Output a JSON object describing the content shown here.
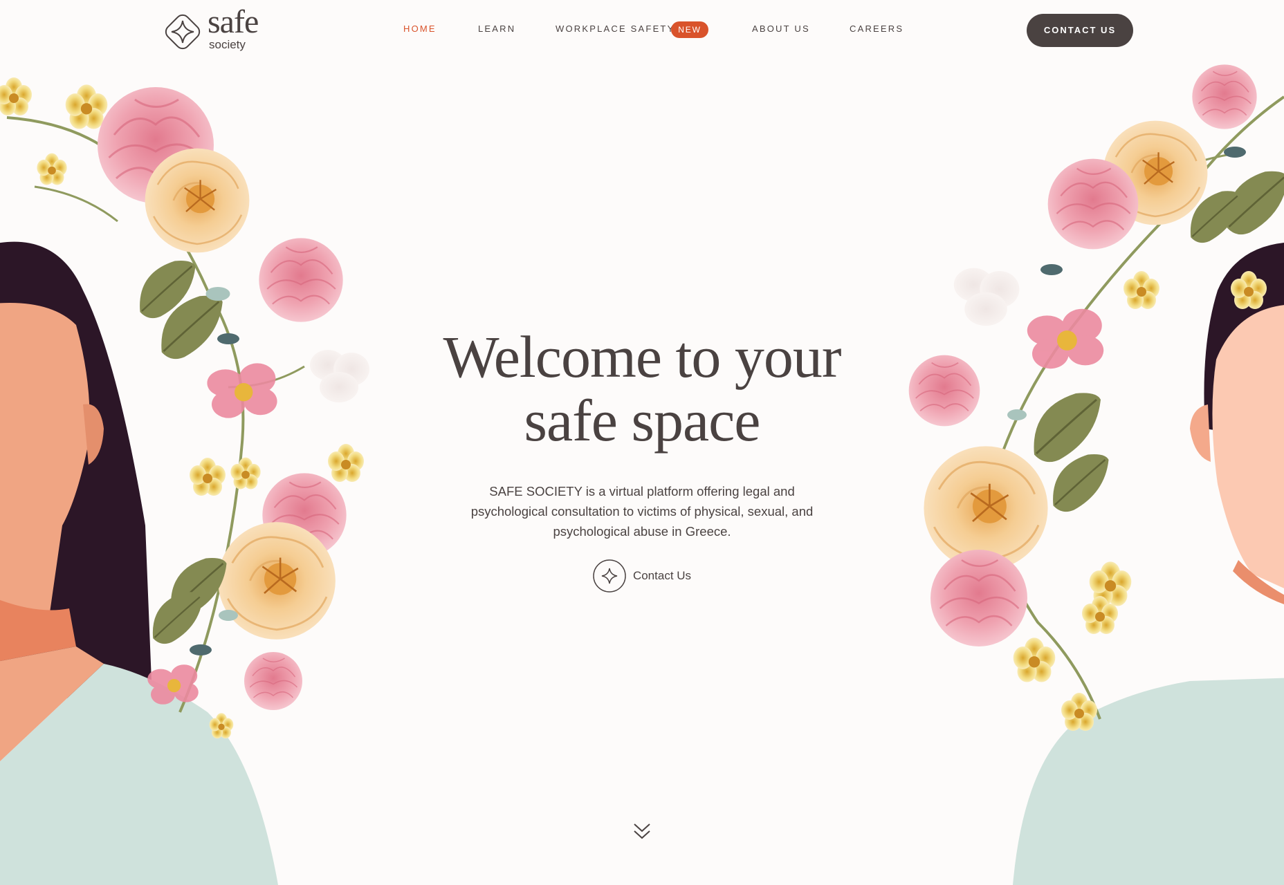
{
  "brand": {
    "name": "safe",
    "tagline": "society"
  },
  "nav": {
    "items": [
      {
        "label": "HOME",
        "active": true
      },
      {
        "label": "LEARN",
        "active": false
      },
      {
        "label": "WORKPLACE SAFETY",
        "active": false
      },
      {
        "label": "ABOUT US",
        "active": false
      },
      {
        "label": "CAREERS",
        "active": false
      }
    ],
    "badge": "NEW",
    "cta_label": "CONTACT US"
  },
  "hero": {
    "title_line1": "Welcome to your",
    "title_line2": "safe space",
    "description": "SAFE SOCIETY is a virtual platform offering legal and psychological consultation to victims of physical, sexual, and psychological abuse in Greece.",
    "cta_label": "Contact Us",
    "cta_icon": "sparkle-icon"
  },
  "scroll_icon": "chevron-double-down-icon",
  "colors": {
    "background": "#fdfbfa",
    "text": "#4a4241",
    "accent": "#d9532b",
    "button": "#4a4241",
    "hair": "#2c1627",
    "skin_left": "#f0a583",
    "skin_right": "#fcc9b2",
    "shirt": "#cfe2dc",
    "peony": "#eea1ad",
    "rose": "#f6cf94",
    "leaf": "#7a7f4a"
  }
}
